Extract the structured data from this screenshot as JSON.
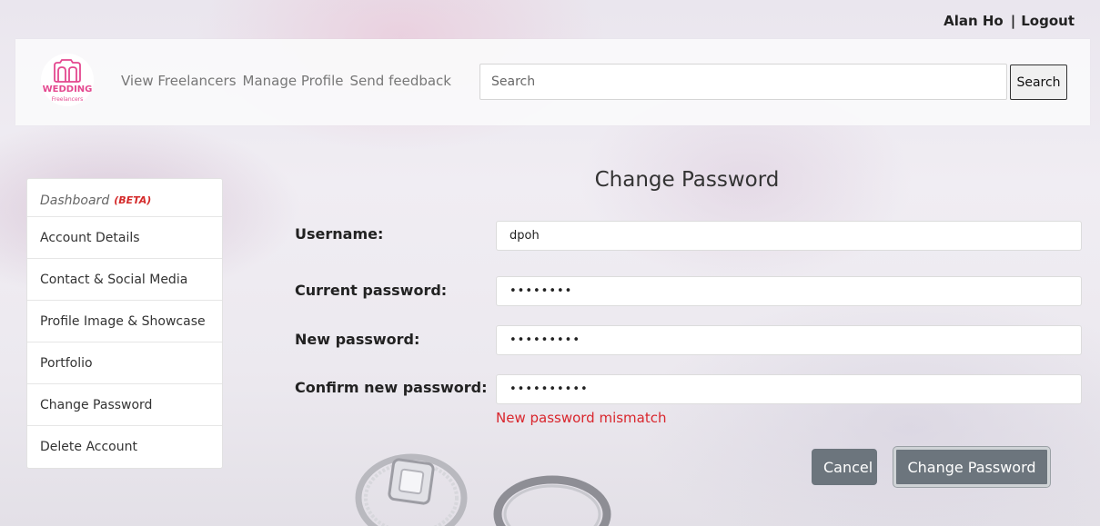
{
  "topbar": {
    "user_name": "Alan Ho",
    "separator": "|",
    "logout_label": "Logout"
  },
  "logo": {
    "line1": "WEDDING",
    "line2": "Freelancers"
  },
  "nav": {
    "links": [
      "View Freelancers",
      "Manage Profile",
      "Send feedback"
    ]
  },
  "search": {
    "placeholder": "Search",
    "button_label": "Search"
  },
  "sidebar": {
    "dashboard_label": "Dashboard",
    "beta_label": "(BETA)",
    "items": [
      "Account Details",
      "Contact & Social Media",
      "Profile Image & Showcase",
      "Portfolio",
      "Change Password",
      "Delete Account"
    ]
  },
  "form": {
    "title": "Change Password",
    "username_label": "Username:",
    "username_value": "dpoh",
    "current_label": "Current password:",
    "current_value": "••••••••",
    "new_label": "New password:",
    "new_value": "•••••••••",
    "confirm_label": "Confirm new password:",
    "confirm_value": "••••••••••",
    "error": "New password mismatch",
    "cancel_label": "Cancel",
    "submit_label": "Change Password"
  },
  "colors": {
    "accent": "#e4488f",
    "error": "#d9262d",
    "button": "#6c757d"
  }
}
